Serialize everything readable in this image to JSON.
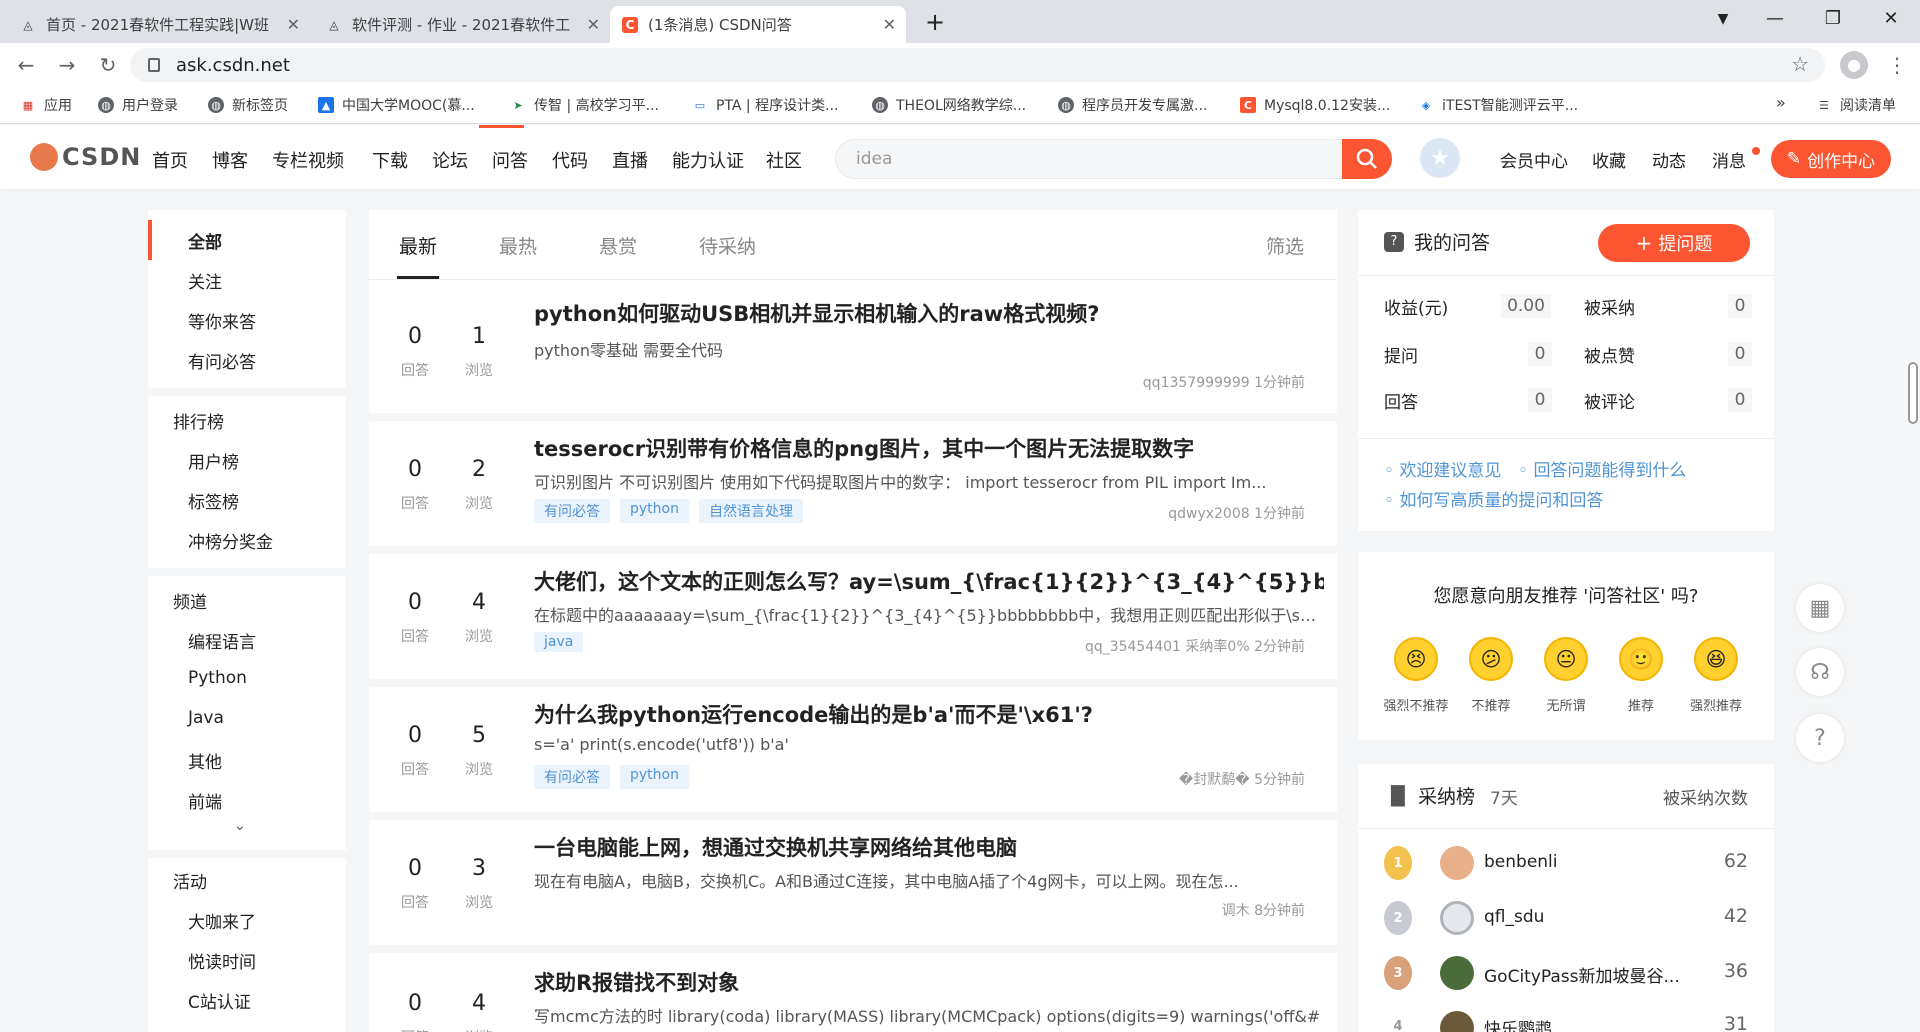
{
  "browser": {
    "tabs": [
      {
        "title": "首页 - 2021春软件工程实践|W班",
        "active": false
      },
      {
        "title": "软件评测 - 作业 - 2021春软件工",
        "active": false
      },
      {
        "title": "(1条消息) CSDN问答",
        "active": true
      }
    ],
    "url": "ask.csdn.net",
    "bookmarks": [
      "应用",
      "用户登录",
      "新标签页",
      "中国大学MOOC(慕...",
      "传智 | 高校学习平...",
      "PTA | 程序设计类...",
      "THEOL网络教学综...",
      "程序员开发专属激...",
      "Mysql8.0.12安装...",
      "iTEST智能测评云平...",
      "阅读清单"
    ],
    "overflow": "»"
  },
  "header": {
    "logo": "CSDN",
    "nav": [
      "首页",
      "博客",
      "专栏视频",
      "下载",
      "论坛",
      "问答",
      "代码",
      "直播",
      "能力认证",
      "社区"
    ],
    "active_nav": "问答",
    "search_placeholder": "idea",
    "right_links": [
      "会员中心",
      "收藏",
      "动态",
      "消息"
    ],
    "create_button": "创作中心",
    "accent": "#fc5531"
  },
  "leftnav": {
    "group1": [
      "全部",
      "关注",
      "等你来答",
      "有问必答"
    ],
    "ranking_title": "排行榜",
    "ranking": [
      "用户榜",
      "标签榜",
      "冲榜分奖金"
    ],
    "channel_title": "频道",
    "channels": [
      "编程语言",
      "Python",
      "Java",
      "其他",
      "前端"
    ],
    "activity_title": "活动",
    "activities": [
      "大咖来了",
      "悦读时间",
      "C站认证"
    ]
  },
  "main": {
    "tabs": [
      "最新",
      "最热",
      "悬赏",
      "待采纳"
    ],
    "filter": "筛选",
    "answer_label": "回答",
    "view_label": "浏览",
    "questions": [
      {
        "answers": "0",
        "views": "1",
        "title": "python如何驱动USB相机并显示相机输入的raw格式视频?",
        "desc": "python零基础 需要全代码",
        "tags": [],
        "meta": "qq1357999999  1分钟前"
      },
      {
        "answers": "0",
        "views": "2",
        "title": "tesserocr识别带有价格信息的png图片，其中一个图片无法提取数字",
        "desc": "可识别图片 不可识别图片  使用如下代码提取图片中的数字： import tesserocr from PIL import Im...",
        "tags": [
          "有问必答",
          "python",
          "自然语言处理"
        ],
        "meta": "qdwyx2008  1分钟前"
      },
      {
        "answers": "0",
        "views": "4",
        "title": "大佬们，这个文本的正则怎么写？ay=\\sum_{\\frac{1}{2}}^{3_{4}^{5}}b",
        "desc": "在标题中的aaaaaaay=\\sum_{\\frac{1}{2}}^{3_{4}^{5}}bbbbbbbb中，我想用正则匹配出形似于\\sum_...",
        "tags": [
          "java"
        ],
        "meta": "qq_35454401  采纳率0%  2分钟前"
      },
      {
        "answers": "0",
        "views": "5",
        "title": "为什么我python运行encode输出的是b'a'而不是'\\x61'?",
        "desc": "s='a' print(s.encode('utf8')) b'a'",
        "tags": [
          "有问必答",
          "python"
        ],
        "meta": "�封默鹬�  5分钟前"
      },
      {
        "answers": "0",
        "views": "3",
        "title": "一台电脑能上网，想通过交换机共享网络给其他电脑",
        "desc": "现在有电脑A，电脑B，交换机C。A和B通过C连接，其中电脑A插了个4g网卡，可以上网。现在怎...",
        "tags": [],
        "meta": "调木  8分钟前"
      },
      {
        "answers": "0",
        "views": "4",
        "title": "求助R报错找不到对象",
        "desc": "写mcmc方法的时 library(coda) library(MASS) library(MCMCpack) options(digits=9) warnings('off&#",
        "tags": [],
        "meta": ""
      }
    ]
  },
  "myq": {
    "title": "我的问答",
    "ask_button": "提问题",
    "stats": [
      {
        "label": "收益(元)",
        "value": "0.00"
      },
      {
        "label": "被采纳",
        "value": "0"
      },
      {
        "label": "提问",
        "value": "0"
      },
      {
        "label": "被点赞",
        "value": "0"
      },
      {
        "label": "回答",
        "value": "0"
      },
      {
        "label": "被评论",
        "value": "0"
      }
    ],
    "links": [
      "欢迎建议意见",
      "回答问题能得到什么",
      "如何写高质量的提问和回答"
    ]
  },
  "recommend": {
    "question": "您愿意向朋友推荐 '问答社区' 吗?",
    "options": [
      "强烈不推荐",
      "不推荐",
      "无所谓",
      "推荐",
      "强烈推荐"
    ],
    "faces": [
      "😣",
      "😕",
      "😐",
      "🙂",
      "😆"
    ]
  },
  "rank": {
    "title": "采纳榜",
    "period": "7天",
    "col": "被采纳次数",
    "rows": [
      {
        "rank": "1",
        "name": "benbenli",
        "count": "62"
      },
      {
        "rank": "2",
        "name": "qfl_sdu",
        "count": "42"
      },
      {
        "rank": "3",
        "name": "GoCityPass新加坡曼谷...",
        "count": "36"
      },
      {
        "rank": "4",
        "name": "快乐鹦鹉",
        "count": "31"
      }
    ]
  }
}
